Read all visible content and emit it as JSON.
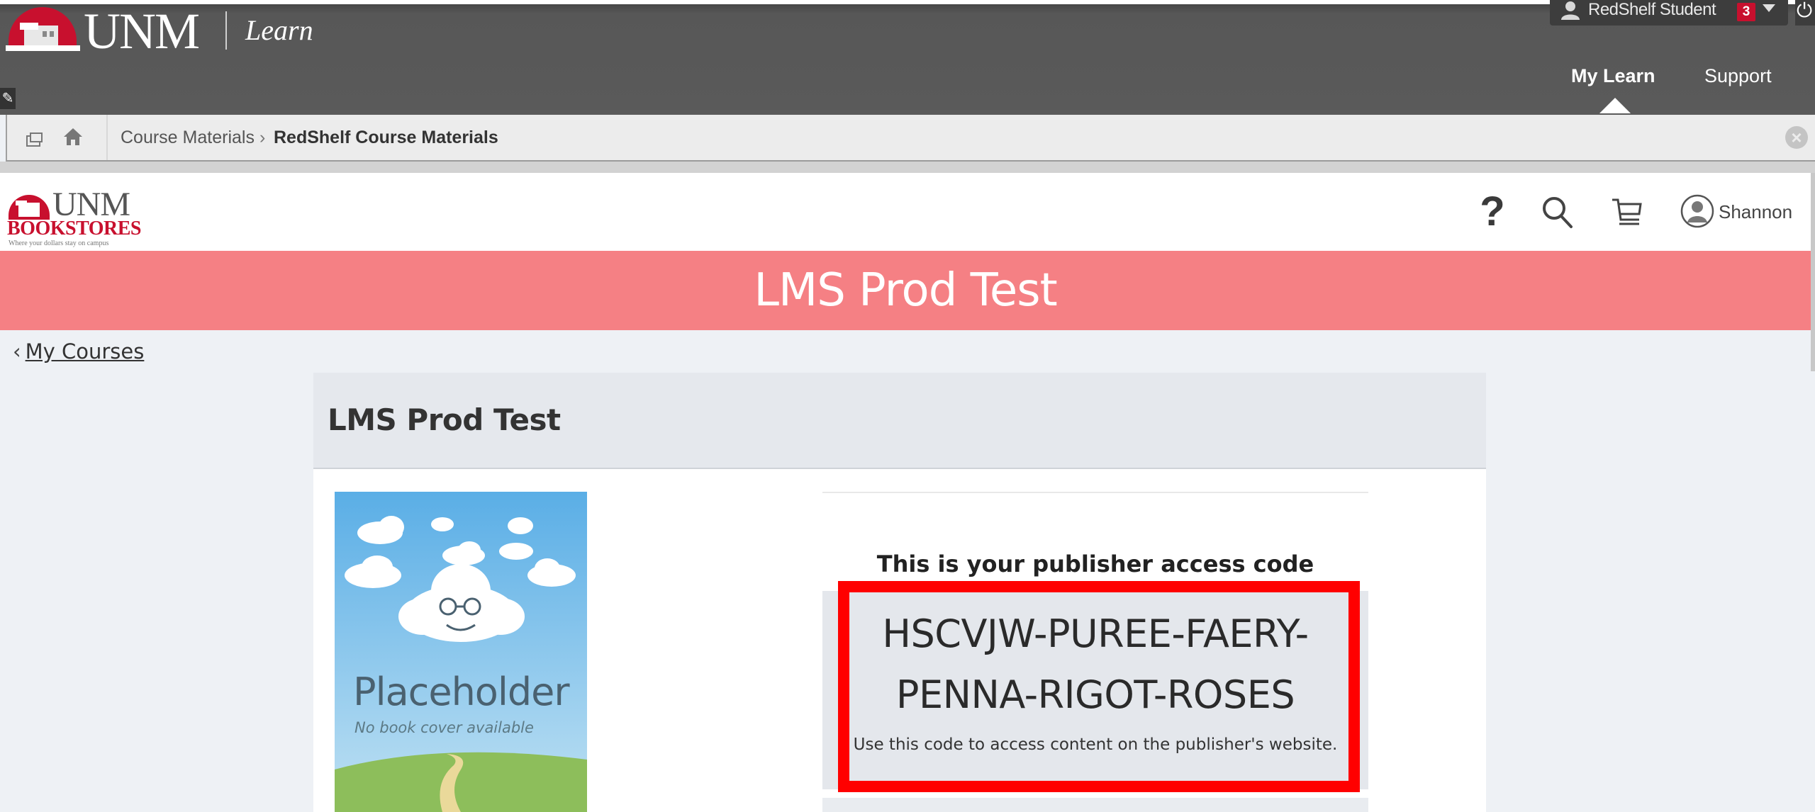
{
  "lms": {
    "brand": "UNM",
    "product": "Learn",
    "user": {
      "name": "RedShelf Student",
      "notifications": "3"
    },
    "tabs": [
      {
        "label": "My Learn",
        "active": true
      },
      {
        "label": "Support",
        "active": false
      }
    ],
    "breadcrumb": [
      "Course Materials",
      "RedShelf Course Materials"
    ],
    "breadcrumb_separator": "›"
  },
  "redshelf": {
    "logo": {
      "top": "UNM",
      "bottom": "BOOKSTORES",
      "tagline": "Where your dollars stay on campus"
    },
    "header_icons": [
      "help-icon",
      "search-icon",
      "cart-icon",
      "account-icon"
    ],
    "help_glyph": "?",
    "account_name": "Shannon",
    "banner_title": "LMS Prod Test",
    "back_link": "My Courses",
    "course": {
      "title": "LMS Prod Test",
      "cover": {
        "title": "Placeholder",
        "subtitle": "No book cover available"
      },
      "access": {
        "heading": "This is your publisher access code",
        "code_line_1": "HSCVJW-PUREE-FAERY-",
        "code_line_2": "PENNA-RIGOT-ROSES",
        "note": "Use this code to access content on the publisher's website."
      }
    }
  },
  "colors": {
    "lms_header": "#575757",
    "unm_red": "#c8102e",
    "banner": "#f58084",
    "highlight": "#ff0000",
    "code_box": "#e4e7ec"
  }
}
